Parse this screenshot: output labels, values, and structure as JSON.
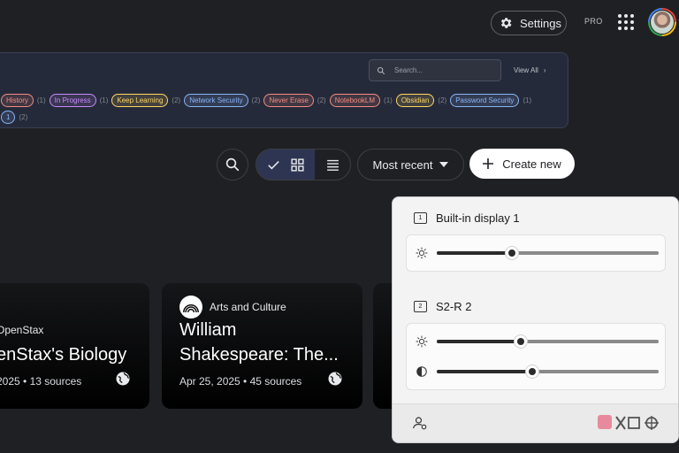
{
  "header": {
    "settings_label": "Settings",
    "plan_badge": "PRO",
    "apps_icon": "apps-grid-icon",
    "avatar_icon": "user-avatar"
  },
  "tags_panel": {
    "search_placeholder": "Search...",
    "view_all_label": "View All",
    "tags": [
      {
        "label": "History",
        "count": "(1)",
        "color": "#f28b82"
      },
      {
        "label": "In Progress",
        "count": "(1)",
        "color": "#c58af9"
      },
      {
        "label": "Keep Learning",
        "count": "(2)",
        "color": "#fdd663"
      },
      {
        "label": "Network Security",
        "count": "(2)",
        "color": "#8ab4f8"
      },
      {
        "label": "Never Erase",
        "count": "(2)",
        "color": "#f28b82"
      },
      {
        "label": "NotebookLM",
        "count": "(1)",
        "color": "#f28b82"
      },
      {
        "label": "Obsidian",
        "count": "(2)",
        "color": "#fdd663"
      },
      {
        "label": "Password Security",
        "count": "(1)",
        "color": "#8ab4f8"
      }
    ],
    "partial_tag": {
      "label": "1",
      "count": "(2)",
      "color": "#8ab4f8"
    }
  },
  "toolbar": {
    "sort_label": "Most recent",
    "create_label": "Create new"
  },
  "cards": [
    {
      "source": "OpenStax",
      "title": "enStax's Biology",
      "meta": "2025 • 13 sources"
    },
    {
      "source": "Arts and Culture",
      "title": "William",
      "title2": "Shakespeare: The...",
      "meta": "Apr 25, 2025 • 45 sources"
    }
  ],
  "display_flyout": {
    "display1_name": "Built-in display 1",
    "display1_number": "1",
    "display1_brightness": 0.34,
    "display2_name": "S2-R 2",
    "display2_number": "2",
    "display2_brightness": 0.38,
    "display2_contrast": 0.43
  },
  "colors": {
    "background": "#1f2023",
    "accent_selected": "#2e3552",
    "create_button": "#ffffff",
    "flyout_bg": "#f3f3f3"
  }
}
